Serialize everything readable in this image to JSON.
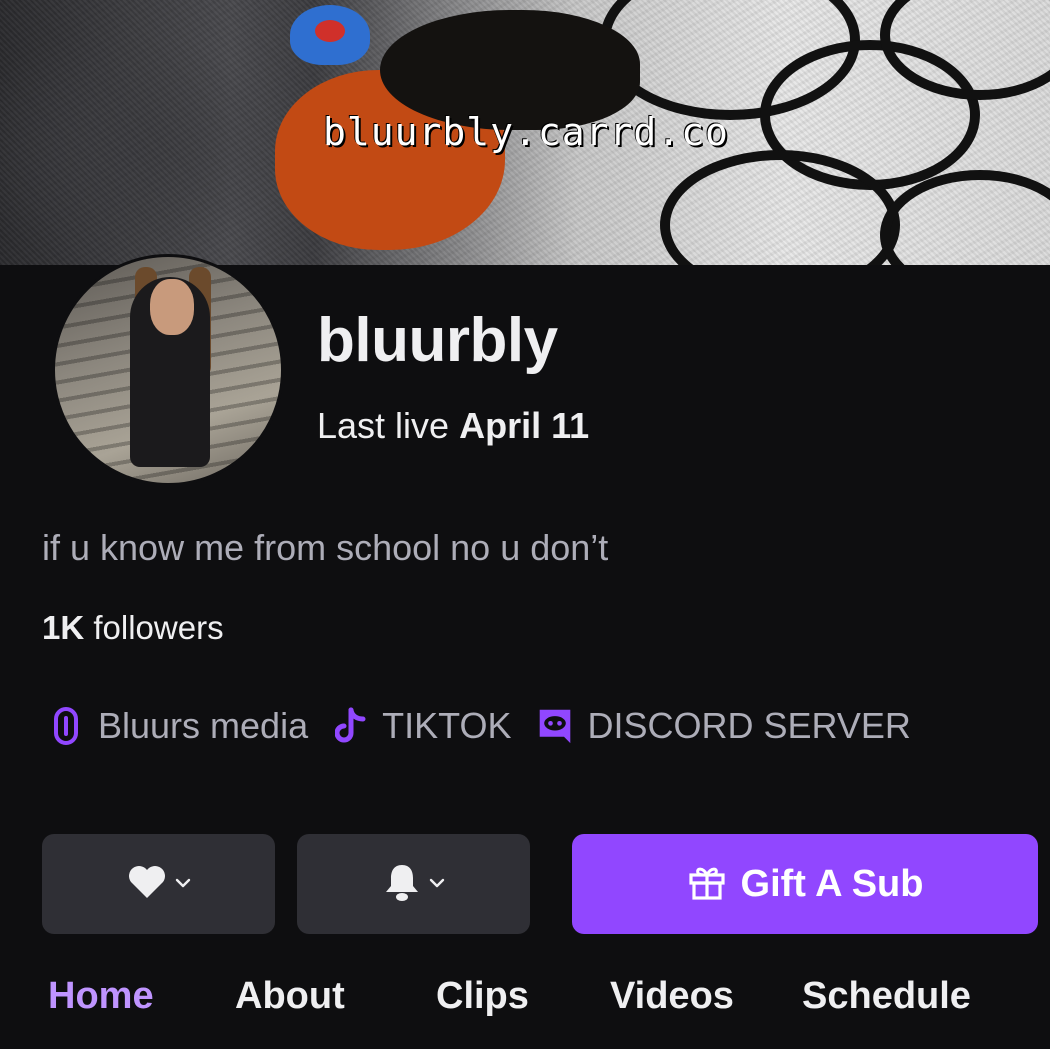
{
  "banner": {
    "text": "bluurbly.carrd.co"
  },
  "profile": {
    "channel_name": "bluurbly",
    "last_live_prefix": "Last live",
    "last_live_date": "April 11",
    "bio": "if u know me from school no u don’t",
    "followers_count": "1K",
    "followers_label": "followers"
  },
  "social_links": [
    {
      "icon": "link-icon",
      "label": "Bluurs media"
    },
    {
      "icon": "tiktok-icon",
      "label": "TIKTOK"
    },
    {
      "icon": "discord-icon",
      "label": "DISCORD SERVER"
    }
  ],
  "actions": {
    "follow_icon": "heart-icon",
    "notify_icon": "bell-icon",
    "gift_icon": "gift-icon",
    "gift_label": "Gift A Sub"
  },
  "tabs": [
    {
      "label": "Home",
      "active": true
    },
    {
      "label": "About",
      "active": false
    },
    {
      "label": "Clips",
      "active": false
    },
    {
      "label": "Videos",
      "active": false
    },
    {
      "label": "Schedule",
      "active": false
    }
  ],
  "colors": {
    "background": "#0e0e10",
    "accent": "#9147ff",
    "accent_text": "#bf94ff",
    "secondary_text": "#adadb8",
    "button_bg": "#2f2f35"
  }
}
